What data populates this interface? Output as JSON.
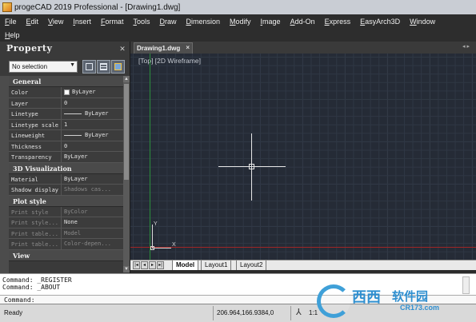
{
  "window": {
    "title": "progeCAD 2019 Professional - [Drawing1.dwg]"
  },
  "menu": {
    "row1": [
      "File",
      "Edit",
      "View",
      "Insert",
      "Format",
      "Tools",
      "Draw",
      "Dimension",
      "Modify",
      "Image",
      "Add-On",
      "Express",
      "EasyArch3D",
      "Window"
    ],
    "row2": [
      "Help"
    ]
  },
  "panel": {
    "title": "Property",
    "selection": "No selection",
    "sections": {
      "general": "General",
      "viz3d": "3D Visualization",
      "plot": "Plot style",
      "view": "View"
    },
    "general": [
      {
        "key": "Color",
        "value": "ByLayer"
      },
      {
        "key": "Layer",
        "value": "0"
      },
      {
        "key": "Linetype",
        "value": "ByLayer"
      },
      {
        "key": "Linetype scale",
        "value": "1"
      },
      {
        "key": "Lineweight",
        "value": "ByLayer"
      },
      {
        "key": "Thickness",
        "value": "0"
      },
      {
        "key": "Transparency",
        "value": "ByLayer"
      }
    ],
    "viz3d": [
      {
        "key": "Material",
        "value": "ByLayer"
      },
      {
        "key": "Shadow display",
        "value": "Shadows cas..."
      }
    ],
    "plot": [
      {
        "key": "Print style",
        "value": "ByColor"
      },
      {
        "key": "Print style...",
        "value": "None"
      },
      {
        "key": "Print table...",
        "value": "Model"
      },
      {
        "key": "Print table...",
        "value": "Color-depen..."
      }
    ]
  },
  "document": {
    "tab": "Drawing1.dwg",
    "view_label": "[Top] [2D Wireframe]",
    "axis_y": "Y",
    "axis_x": "X",
    "layouts": [
      "Model",
      "Layout1",
      "Layout2"
    ]
  },
  "command": {
    "history": [
      "Command: _REGISTER",
      "Command: _ABOUT"
    ],
    "prompt": "Command:"
  },
  "status": {
    "state": "Ready",
    "coords": "206.964,166.9384,0",
    "scale": "1:1"
  },
  "watermark": {
    "text": "西西",
    "text2": "软件园",
    "url": "CR173.com"
  }
}
